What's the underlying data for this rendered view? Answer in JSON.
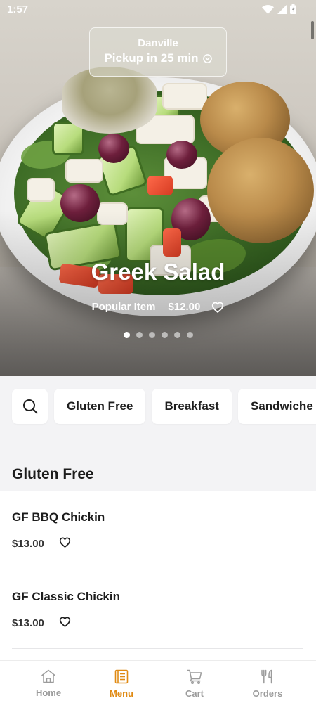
{
  "status_bar": {
    "time": "1:57"
  },
  "hero": {
    "location": "Danville",
    "pickup": "Pickup in 25 min",
    "title": "Greek Salad",
    "tag": "Popular Item",
    "price": "$12.00",
    "slide_count": 6,
    "active_slide": 1
  },
  "categories": [
    "Gluten Free",
    "Breakfast",
    "Sandwiche"
  ],
  "section": {
    "title": "Gluten Free",
    "items": [
      {
        "name": "GF BBQ Chickin",
        "price": "$13.00"
      },
      {
        "name": "GF Classic Chickin",
        "price": "$13.00"
      }
    ]
  },
  "nav": [
    {
      "label": "Home",
      "icon": "home-icon"
    },
    {
      "label": "Menu",
      "icon": "menu-book-icon"
    },
    {
      "label": "Cart",
      "icon": "cart-icon"
    },
    {
      "label": "Orders",
      "icon": "utensils-icon"
    }
  ],
  "colors": {
    "accent": "#e08a13",
    "inactive": "#9b9b9b",
    "background": "#f3f3f5"
  }
}
